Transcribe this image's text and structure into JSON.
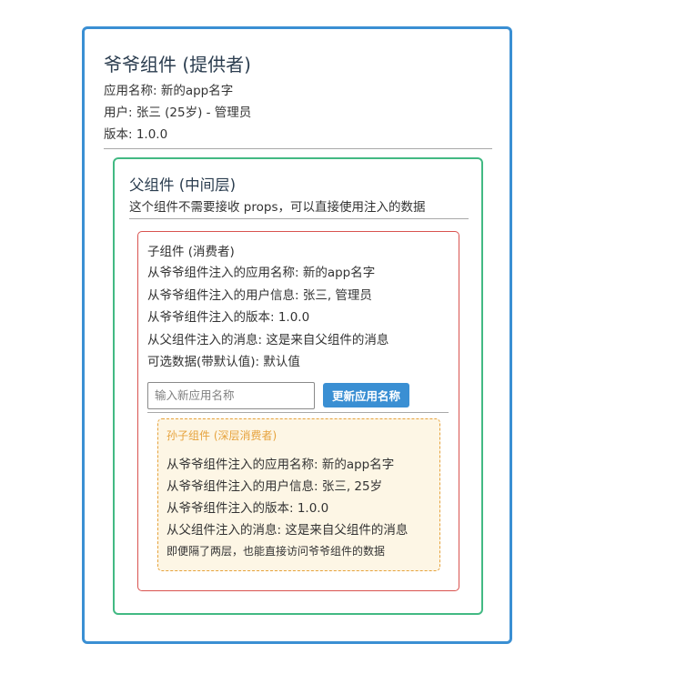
{
  "grandparent": {
    "title": "爷爷组件 (提供者)",
    "app_name_line": "应用名称: 新的app名字",
    "user_line": "用户: 张三 (25岁) - 管理员",
    "version_line": "版本: 1.0.0"
  },
  "parent": {
    "title": "父组件 (中间层)",
    "description": "这个组件不需要接收 props，可以直接使用注入的数据"
  },
  "child": {
    "title": "子组件 (消费者)",
    "lines": [
      "从爷爷组件注入的应用名称: 新的app名字",
      "从爷爷组件注入的用户信息: 张三, 管理员",
      "从爷爷组件注入的版本: 1.0.0",
      "从父组件注入的消息: 这是来自父组件的消息",
      "可选数据(带默认值): 默认值"
    ],
    "input": {
      "placeholder": "输入新应用名称",
      "value": ""
    },
    "update_button_label": "更新应用名称"
  },
  "grandchild": {
    "title": "孙子组件 (深层消费者)",
    "lines": [
      "从爷爷组件注入的应用名称: 新的app名字",
      "从爷爷组件注入的用户信息: 张三, 25岁",
      "从爷爷组件注入的版本: 1.0.0",
      "从父组件注入的消息: 这是来自父组件的消息"
    ],
    "note": "即便隔了两层，也能直接访问爷爷组件的数据"
  }
}
